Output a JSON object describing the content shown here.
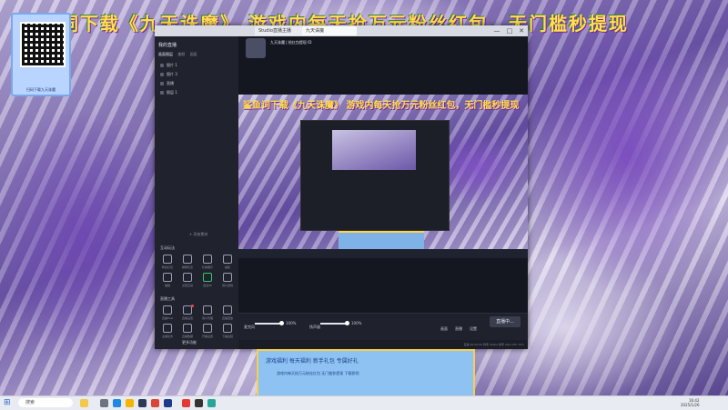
{
  "desktop": {
    "banner_text": "鲨鱼词下载《九天诛魔》 游戏内每天抢万元粉丝红包，无门槛秒提现",
    "qr_caption": "扫码下载九天诛魔"
  },
  "window": {
    "tabs": [
      {
        "label": "Studio直播主播"
      },
      {
        "label": "九天诛魔"
      }
    ],
    "controls": {
      "minimize": "—",
      "maximize": "□",
      "close": "✕"
    }
  },
  "sidebar": {
    "title": "我的直播",
    "tabs": [
      "画面图层",
      "美颜",
      "画面"
    ],
    "scenes": [
      "图片 1",
      "图片 3",
      "直播",
      "图层 1"
    ],
    "add_source": "+ 添加素材",
    "interact_title": "互动玩法",
    "interact_tools": [
      "粉丝红包",
      "弹幕玩法",
      "礼物展示",
      "抽奖",
      "福袋",
      "点赞互动",
      "连麦PK",
      "观众连线"
    ],
    "anchor_title": "直播工具",
    "anchor_tools": [
      "直播Plus",
      "直播设置",
      "观众管理",
      "直播回放",
      "主播任务",
      "直播数据",
      "开播设置",
      "下播总结"
    ],
    "more_label": "更多功能"
  },
  "stream": {
    "streamer_name": "九天诛魔 | 抢红包提现 ID",
    "preview_banner": "鲨鱼词下载《九天诛魔》 游戏内每天抢万元粉丝红包，无门槛秒提现",
    "mic_label": "麦克风",
    "mic_value": "100%",
    "speaker_label": "扬声器",
    "speaker_value": "100%",
    "right_icons": [
      "画面",
      "直播",
      "设置"
    ],
    "live_button": "直播中...",
    "status_text": "直播 00:00:00   码率 0kbps   帧率 0fps   CPU 15%"
  },
  "promo": {
    "line1": "游戏福利  每天福利  新手礼包  专属好礼",
    "line2": "游戏内每天抢万元粉丝红包 无门槛秒提现 下载即领"
  },
  "taskbar": {
    "search_placeholder": "搜索",
    "time": "16:42",
    "date": "2025/1/26"
  }
}
